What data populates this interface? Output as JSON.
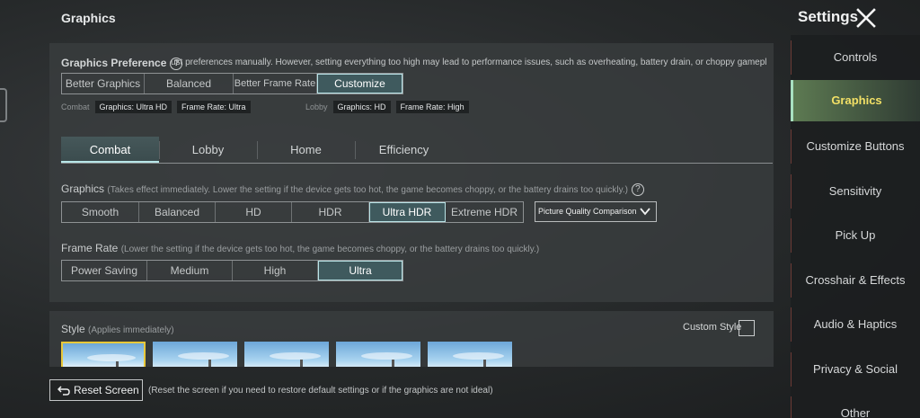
{
  "header": {
    "section_title": "Graphics",
    "settings_title": "Settings"
  },
  "preference": {
    "label": "Graphics Preference",
    "help": "?",
    "description": "ust preferences manually. However, setting everything too high may lead to performance issues, such as overheating, battery drain, or choppy gamepl",
    "options": [
      "Better Graphics",
      "Balanced",
      "Better Frame Rate",
      "Customize"
    ],
    "selected": "Customize"
  },
  "presets": {
    "combat_label": "Combat",
    "combat_tags": [
      "Graphics: Ultra HD",
      "Frame Rate: Ultra"
    ],
    "lobby_label": "Lobby",
    "lobby_tags": [
      "Graphics: HD",
      "Frame Rate: High"
    ]
  },
  "tabs": [
    "Combat",
    "Lobby",
    "Home",
    "Efficiency"
  ],
  "active_tab": "Combat",
  "graphics": {
    "label": "Graphics",
    "hint": "(Takes effect immediately. Lower the setting if the device gets too hot, the game becomes choppy, or the battery drains too quickly.)",
    "help": "?",
    "options": [
      "Smooth",
      "Balanced",
      "HD",
      "HDR",
      "Ultra HDR",
      "Extreme HDR"
    ],
    "selected": "Ultra HDR",
    "comparison_label": "Picture Quality Comparison"
  },
  "frame_rate": {
    "label": "Frame Rate",
    "hint": "(Lower the setting if the device gets too hot, the game becomes choppy, or the battery drains too quickly.)",
    "options": [
      "Power Saving",
      "Medium",
      "High",
      "Ultra"
    ],
    "selected": "Ultra"
  },
  "style": {
    "label": "Style",
    "hint": "(Applies immediately)",
    "custom_label": "Custom Style",
    "custom_checked": false
  },
  "reset": {
    "button_label": "Reset Screen",
    "hint": "(Reset the screen if you need to restore default settings or if the graphics are not ideal)"
  },
  "sidebar": {
    "items": [
      "Controls",
      "Graphics",
      "Customize Buttons",
      "Sensitivity",
      "Pick Up",
      "Crosshair & Effects",
      "Audio & Haptics",
      "Privacy & Social",
      "Other"
    ],
    "active": "Graphics"
  },
  "colors": {
    "accent": "#b9e3e6",
    "active_sidebar_text": "#f2e066",
    "selected_thumb_border": "#e8c83a"
  }
}
